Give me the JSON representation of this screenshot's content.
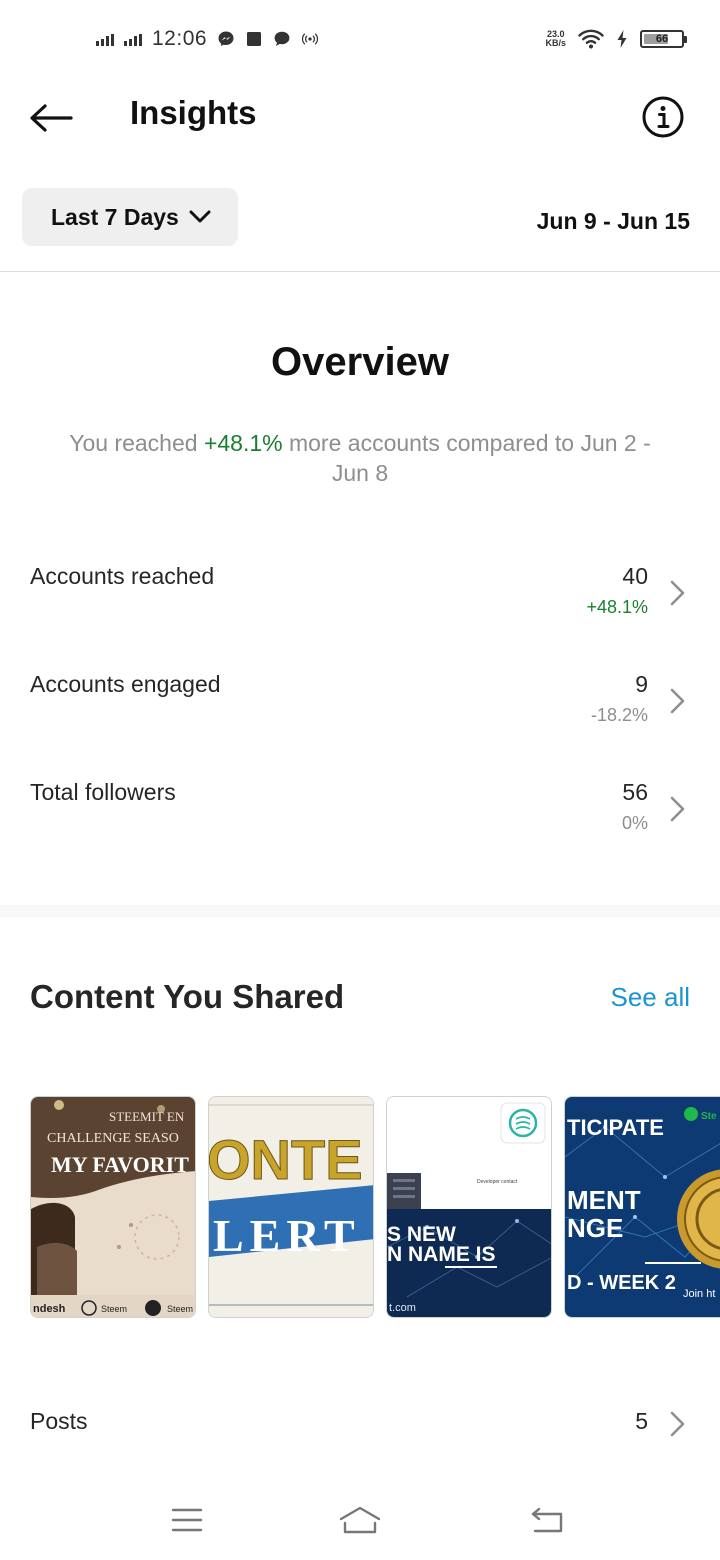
{
  "status_bar": {
    "time": "12:06",
    "net_speed_value": "23.0",
    "net_speed_unit": "KB/s",
    "battery_level": "66",
    "icons": [
      "signal-icon",
      "signal-icon",
      "messenger-icon",
      "square-icon",
      "chat-icon",
      "hotspot-icon",
      "wifi-icon",
      "charging-icon",
      "battery-icon"
    ]
  },
  "header": {
    "title": "Insights",
    "back_icon": "arrow-left-icon",
    "info_icon": "info-icon"
  },
  "filter": {
    "range_label": "Last 7 Days",
    "range_icon": "chevron-down-icon",
    "date_range": "Jun 9 - Jun 15"
  },
  "overview": {
    "title": "Overview",
    "summary_prefix": "You reached ",
    "summary_highlight": "+48.1%",
    "summary_suffix": " more accounts compared to Jun 2 - Jun 8",
    "metrics": [
      {
        "label": "Accounts reached",
        "value": "40",
        "change": "+48.1%",
        "positive": true
      },
      {
        "label": "Accounts engaged",
        "value": "9",
        "change": "-18.2%",
        "positive": false
      },
      {
        "label": "Total followers",
        "value": "56",
        "change": "0%",
        "positive": false
      }
    ]
  },
  "content_shared": {
    "title": "Content You Shared",
    "see_all": "See all",
    "thumbnails": [
      {
        "line1": "STEEMIT EN",
        "line2": "CHALLENGE SEASO",
        "line3": "MY FAVORIT",
        "footer1": "ndesh",
        "footer2": "Steem",
        "footer3": "Steem"
      },
      {
        "line1": "ONTE",
        "line2": "LERT"
      },
      {
        "line1": "Developer contact",
        "line2": "S NEW",
        "line3": "N NAME IS",
        "footer1": "t.com"
      },
      {
        "line1": "TICIPATE",
        "line2": "MENT",
        "line3": "NGE",
        "line4": "D - WEEK 2",
        "footer1": "Join ht",
        "badge": "Ste"
      }
    ],
    "posts_label": "Posts",
    "posts_count": "5"
  },
  "nav_bar": {
    "icons": [
      "menu-icon",
      "home-icon",
      "back-icon"
    ]
  },
  "colors": {
    "accent_blue": "#1b94d2",
    "positive_green": "#1a7f2e",
    "muted_gray": "#8e8e8e"
  }
}
